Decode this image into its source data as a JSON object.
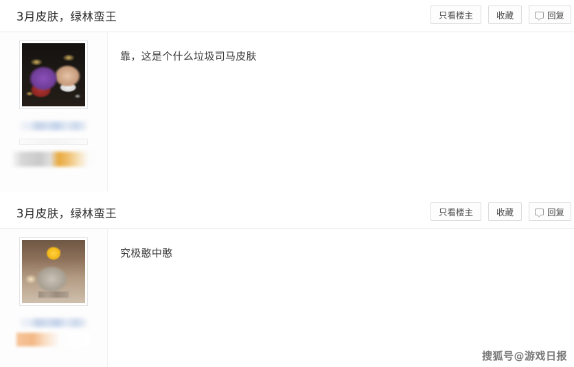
{
  "posts": [
    {
      "title": "3月皮肤，绿林蛮王",
      "actions": {
        "only_op_label": "只看楼主",
        "favorite_label": "收藏",
        "reply_label": "回复",
        "reply_icon": "speech-bubble-icon"
      },
      "author": {
        "avatar_alt": "purple-hero-meme-avatar",
        "username_blurred": true
      },
      "comment": "靠，这是个什么垃圾司马皮肤"
    },
    {
      "title": "3月皮肤，绿林蛮王",
      "actions": {
        "only_op_label": "只看楼主",
        "favorite_label": "收藏",
        "reply_label": "回复",
        "reply_icon": "speech-bubble-icon"
      },
      "author": {
        "avatar_alt": "cat-with-yellow-duck-avatar",
        "username_blurred": true
      },
      "comment": "究极憨中憨"
    }
  ],
  "watermark": {
    "text": "搜狐号@游戏日报"
  },
  "colors": {
    "page_background": "#ffffff",
    "text_primary": "#2b2b2b",
    "text_comment": "#3a3a3a",
    "button_border": "#dcdcdc",
    "divider": "#e8e8e8"
  }
}
